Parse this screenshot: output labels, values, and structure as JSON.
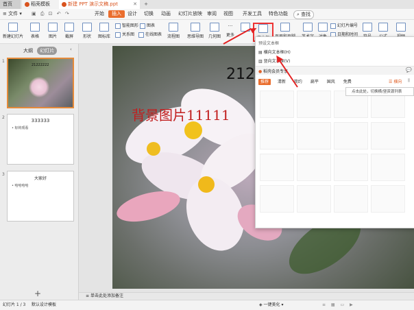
{
  "titlebar": {
    "home_tab": "首页",
    "docer_tab": "稻壳模板",
    "doc_tab": "新建 PPT 演示文稿.ppt",
    "add_tab": "+"
  },
  "menubar": {
    "file": "文件",
    "items": [
      "开始",
      "插入",
      "设计",
      "切换",
      "动画",
      "幻灯片放映",
      "审阅",
      "视图",
      "开发工具",
      "特色功能"
    ],
    "search": "查找"
  },
  "ribbon": {
    "new_slide": "新建幻灯片",
    "table": "表格",
    "image": "图片",
    "screenshot": "截屏",
    "shape": "形状",
    "icon_lib": "图标库",
    "smart_graphic": "智能图形",
    "chart": "图表",
    "relation": "关系图",
    "online_chart": "在线图表",
    "flowchart": "流程图",
    "mindmap": "思维导图",
    "geometry": "几何图",
    "more": "更多",
    "textbox": "文本框",
    "header_footer": "页眉和页脚",
    "wordart": "艺术字",
    "object": "对象",
    "slide_number": "幻灯片编号",
    "datetime": "日期和时间",
    "symbol": "符号",
    "formula": "公式",
    "video": "视频"
  },
  "leftpanel": {
    "tab_outline": "大纲",
    "tab_slides": "幻灯片",
    "thumbs": [
      {
        "num": "1",
        "title": "21222222"
      },
      {
        "num": "2",
        "title": "333333",
        "bullet": "• 标钩观看"
      },
      {
        "num": "3",
        "title": "大家好",
        "bullet": "• 哈哈哈哈"
      }
    ]
  },
  "slide": {
    "text_bg": "背景图片11111",
    "text_num": "212"
  },
  "dropdown": {
    "section": "预设文本框",
    "horizontal": "横向文本框(H)",
    "vertical": "竖向文本框(V)",
    "member_banner": "稻壳会员专享",
    "filters": [
      "推荐",
      "清新",
      "简约",
      "扁平",
      "国风",
      "免费"
    ],
    "orient_label": "横向",
    "tooltip": "点击此处，切换横/竖资源列表"
  },
  "notes": {
    "text": "单击此处添加备注"
  },
  "status": {
    "slide_count": "幻灯片 1 / 3",
    "template": "默认设计模板",
    "beautify": "一键美化"
  }
}
